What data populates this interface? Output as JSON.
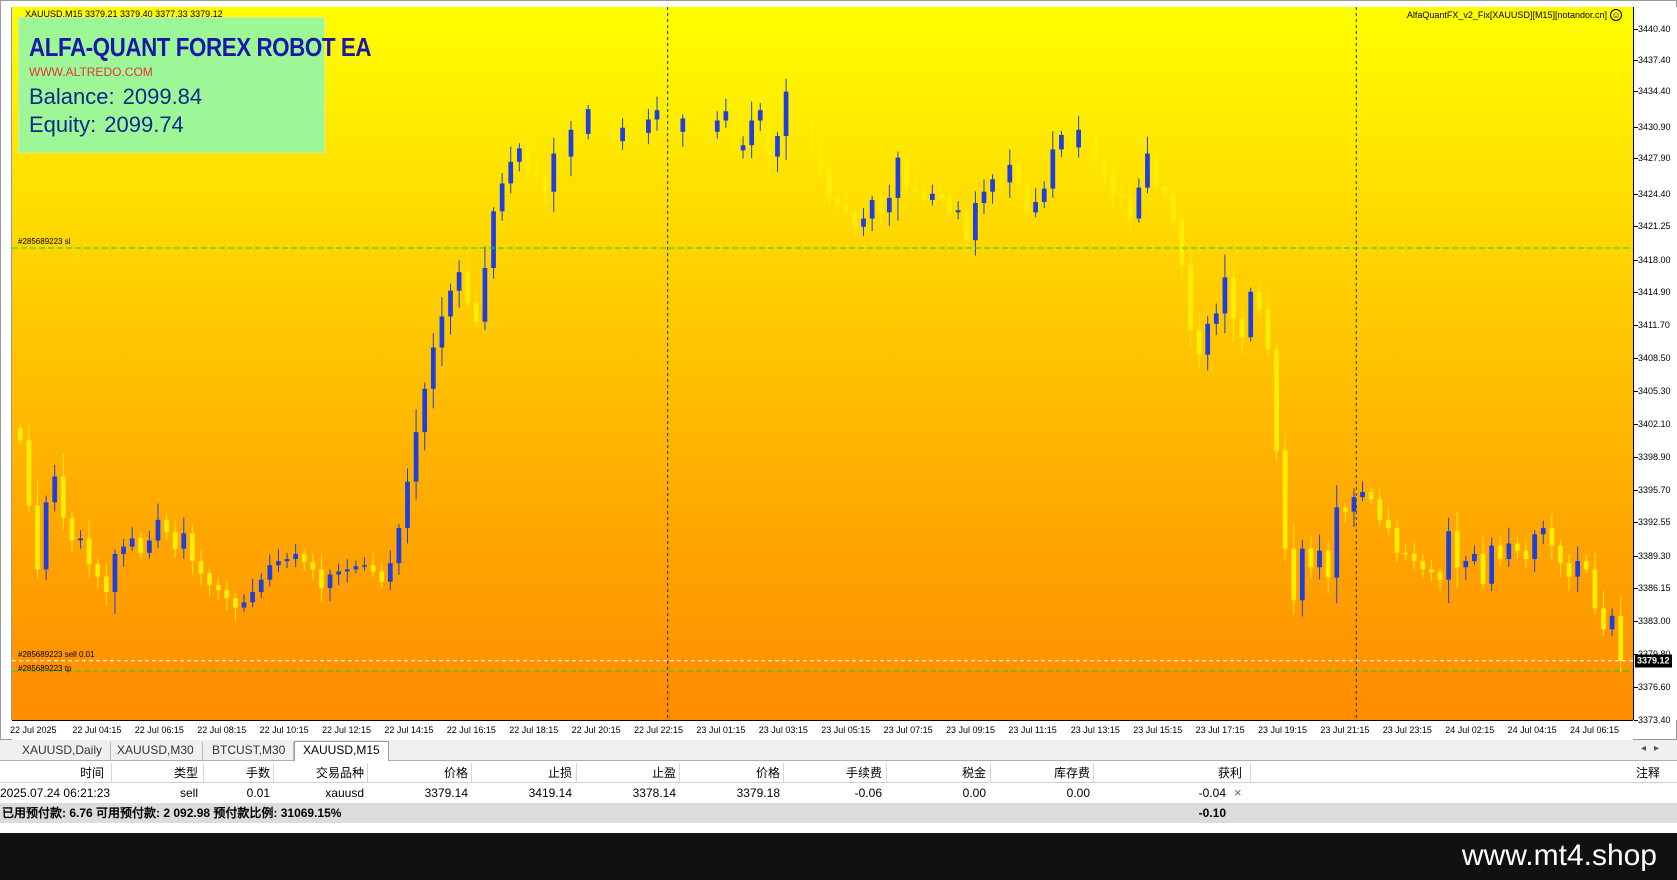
{
  "chart": {
    "header": "XAUUSD,M15  3379.21 3379.40 3377.33 3379.12",
    "ea_label": "AlfaQuantFX_v2_Fix[XAUUSD][M15][notandor.cn]",
    "icon": "smiley-icon"
  },
  "info_panel": {
    "title": "ALFA-QUANT FOREX ROBOT EA",
    "url": "WWW.ALTREDO.COM",
    "balance_label": "Balance:",
    "balance_value": "2099.84",
    "equity_label": "Equity:",
    "equity_value": "2099.74"
  },
  "order_lines": {
    "sl_label": "#285689223 sl",
    "entry_label": "#285689223 sell 0.01",
    "tp_label": "#285689223 tp"
  },
  "chart_data": {
    "type": "candlestick",
    "symbol": "XAUUSD",
    "timeframe": "M15",
    "ylim": [
      3373.4,
      3442.5
    ],
    "price_ticks": [
      "3440.40",
      "3437.40",
      "3434.40",
      "3430.90",
      "3427.90",
      "3424.40",
      "3421.25",
      "3418.00",
      "3414.90",
      "3411.70",
      "3408.50",
      "3405.30",
      "3402.10",
      "3398.90",
      "3395.70",
      "3392.55",
      "3389.30",
      "3386.15",
      "3383.00",
      "3379.80",
      "3376.60",
      "3373.40"
    ],
    "time_ticks": [
      "22 Jul 2025",
      "22 Jul 04:15",
      "22 Jul 06:15",
      "22 Jul 08:15",
      "22 Jul 10:15",
      "22 Jul 12:15",
      "22 Jul 14:15",
      "22 Jul 16:15",
      "22 Jul 18:15",
      "22 Jul 20:15",
      "22 Jul 22:15",
      "23 Jul 01:15",
      "23 Jul 03:15",
      "23 Jul 05:15",
      "23 Jul 07:15",
      "23 Jul 09:15",
      "23 Jul 11:15",
      "23 Jul 13:15",
      "23 Jul 15:15",
      "23 Jul 17:15",
      "23 Jul 19:15",
      "23 Jul 21:15",
      "23 Jul 23:15",
      "24 Jul 02:15",
      "24 Jul 04:15",
      "24 Jul 06:15"
    ],
    "current_price": "3379.12",
    "sl_price": 3419.14,
    "entry_price": 3379.14,
    "tp_price": 3378.14,
    "period_separators": [
      "23 Jul 00:00",
      "24 Jul 00:00"
    ],
    "closes": [
      3400.5,
      3394.2,
      3388.0,
      3394.5,
      3397.0,
      3393.0,
      3390.8,
      3391.0,
      3388.5,
      3387.3,
      3385.8,
      3389.5,
      3390.2,
      3391.0,
      3389.6,
      3390.8,
      3392.8,
      3391.6,
      3390.0,
      3391.5,
      3388.8,
      3387.6,
      3386.5,
      3386.0,
      3385.2,
      3384.3,
      3384.8,
      3385.8,
      3387.0,
      3388.4,
      3388.8,
      3389.0,
      3389.5,
      3388.7,
      3388.0,
      3386.2,
      3387.5,
      3387.8,
      3388.0,
      3388.3,
      3388.4,
      3387.8,
      3386.8,
      3388.6,
      3392.0,
      3396.5,
      3401.3,
      3405.5,
      3409.5,
      3412.5,
      3415.0,
      3416.8,
      3413.8,
      3412.0,
      3417.2,
      3422.7,
      3425.4,
      3427.5,
      3428.8,
      3426.7,
      3426.0,
      3424.6,
      3428.3,
      3428.0,
      3430.6,
      3430.2,
      3432.6,
      3432.0,
      3431.5,
      3429.5,
      3430.8,
      3430.5,
      3430.3,
      3431.6,
      3432.5,
      3431.9,
      3430.4,
      3431.7,
      3431.5,
      3431.0,
      3430.4,
      3431.5,
      3432.4,
      3428.6,
      3429.1,
      3431.5,
      3432.5,
      3428.0,
      3430.0,
      3434.3,
      3432.3,
      3431.6,
      3428.7,
      3426.8,
      3424.0,
      3423.3,
      3422.5,
      3421.2,
      3422.0,
      3423.8,
      3422.6,
      3424.0,
      3427.9,
      3425.1,
      3424.6,
      3423.8,
      3424.4,
      3424.0,
      3422.6,
      3422.8,
      3419.9,
      3423.5,
      3424.6,
      3425.8,
      3425.5,
      3427.2,
      3425.3,
      3422.6,
      3423.6,
      3424.9,
      3428.7,
      3430.1,
      3428.9,
      3430.6,
      3430.5,
      3427.8,
      3426.3,
      3424.4,
      3424.0,
      3422.0,
      3425.0,
      3428.3,
      3425.2,
      3424.3,
      3421.8,
      3417.5,
      3411.2,
      3408.8,
      3411.8,
      3412.8,
      3416.3,
      3412.3,
      3410.5,
      3414.9,
      3413.2,
      3409.3,
      3399.5,
      3390.0,
      3385.0,
      3390.0,
      3388.2,
      3389.8,
      3387.2,
      3394.0,
      3393.6,
      3395.0,
      3395.5,
      3394.8,
      3392.8,
      3392.0,
      3389.6,
      3389.5,
      3388.8,
      3388.0,
      3387.7,
      3387.0,
      3391.7,
      3388.2,
      3388.8,
      3389.5,
      3386.6,
      3390.3,
      3389.0,
      3390.5,
      3389.8,
      3389.0,
      3391.4,
      3392.0,
      3390.3,
      3388.6,
      3387.3,
      3388.8,
      3388.0,
      3384.2,
      3382.2,
      3383.5,
      3379.12
    ]
  },
  "tabs": [
    {
      "label": "XAUUSD,Daily",
      "active": false
    },
    {
      "label": "XAUUSD,M30",
      "active": false
    },
    {
      "label": "BTCUST,M30",
      "active": false
    },
    {
      "label": "XAUUSD,M15",
      "active": true
    }
  ],
  "terminal": {
    "headers": [
      "时间",
      "类型",
      "手数",
      "交易品种",
      "价格",
      "止损",
      "止盈",
      "价格",
      "手续费",
      "税金",
      "库存费",
      "获利",
      "注释"
    ],
    "order": {
      "time": "2025.07.24 06:21:23",
      "type": "sell",
      "lots": "0.01",
      "symbol": "xauusd",
      "open_price": "3379.14",
      "sl": "3419.14",
      "tp": "3378.14",
      "price": "3379.18",
      "commission": "-0.06",
      "taxes": "0.00",
      "swap": "0.00",
      "profit": "-0.04",
      "close_icon": "×"
    },
    "summary": {
      "text": "已用预付款: 6.76  可用预付款: 2 092.98  预付款比例: 31069.15%",
      "total_profit": "-0.10"
    }
  },
  "footer": {
    "brand": "www.mt4.shop"
  },
  "colors": {
    "bull_candle": "#1f3fdd",
    "bear_candle": "#ffee00",
    "sl_line": "#22cc22",
    "tp_line": "#22cc22",
    "entry_line": "#ffffff",
    "info_panel_bg": "#9ef797",
    "title_color": "#1a18a8",
    "url_color": "#e53535"
  }
}
